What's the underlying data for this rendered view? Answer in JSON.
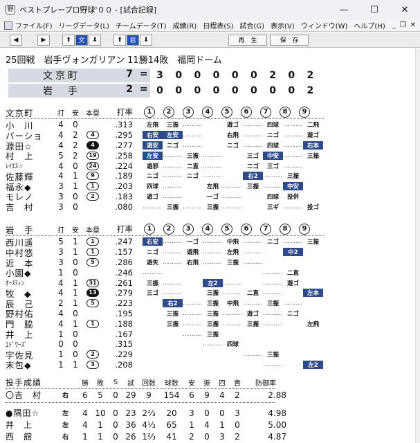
{
  "window": {
    "title": "ベストプレープロ野球'００ - [試合記録]",
    "minimize": "—",
    "maximize": "☐",
    "close": "✕",
    "app_icon": "野"
  },
  "menu": [
    "ファイル(F)",
    "リーグデータ(L)",
    "チームデータ(T)",
    "成績(R)",
    "日程表(S)",
    "試合(G)",
    "表示(V)",
    "ウィンドウ(W)",
    "ヘルプ(H)"
  ],
  "mdi": {
    "minimize": "_",
    "restore": "❐",
    "close": "✕"
  },
  "toolbar": {
    "left": "◀",
    "right": "▶",
    "up1": "⬆",
    "team1": "文",
    "down1": "⬇",
    "up2": "⬆",
    "team2": "岩",
    "down2": "⬇",
    "replay": "再　生",
    "save": "保　存"
  },
  "game": {
    "info": "25回戦　岩手ヴォンガリアン 11勝14敗　福岡ドーム"
  },
  "scoreboard": [
    {
      "team": "文京町",
      "total": "7",
      "dash": "=",
      "innings": [
        "3",
        "0",
        "0",
        "0",
        "0",
        "0",
        "2",
        "0",
        "2"
      ]
    },
    {
      "team": "岩　手",
      "total": "2",
      "dash": "=",
      "innings": [
        "0",
        "0",
        "0",
        "0",
        "0",
        "0",
        "0",
        "0",
        "2"
      ]
    }
  ],
  "headers": {
    "ab": "打",
    "h": "安",
    "hr": "本塁",
    "avg": "打率"
  },
  "inning_labels": [
    "1",
    "2",
    "3",
    "4",
    "5",
    "6",
    "7",
    "8",
    "9"
  ],
  "home": {
    "team": "文京町",
    "players": [
      {
        "name": "小　川",
        "ab": "4",
        "h": "0",
        "hr": "",
        "hrfill": false,
        "avg": ".313",
        "inn": [
          [
            "左飛",
            0
          ],
          [
            "三振",
            0
          ],
          [
            "…………",
            2
          ],
          [
            "",
            2
          ],
          [
            "遊ゴ",
            0
          ],
          [
            "…………",
            2
          ],
          [
            "四球",
            0
          ],
          [
            "…………",
            2
          ],
          [
            "二飛",
            0
          ]
        ]
      },
      {
        "name": "バーショ",
        "ab": "4",
        "h": "2",
        "hr": "4",
        "hrfill": false,
        "avg": ".295",
        "inn": [
          [
            "右安",
            1
          ],
          [
            "左安",
            1
          ],
          [
            "…………",
            2
          ],
          [
            "",
            2
          ],
          [
            "右飛",
            0
          ],
          [
            "…………",
            2
          ],
          [
            "ニゴ",
            0
          ],
          [
            "…………",
            2
          ],
          [
            "遊ゴ",
            0
          ]
        ]
      },
      {
        "name": "源田☆",
        "ab": "4",
        "h": "2",
        "hr": "4",
        "hrfill": true,
        "avg": ".277",
        "inn": [
          [
            "遊安",
            1
          ],
          [
            "ニゴ",
            0
          ],
          [
            "…………",
            2
          ],
          [
            "",
            2
          ],
          [
            "ニゴ",
            0
          ],
          [
            "…………",
            2
          ],
          [
            "四球",
            0
          ],
          [
            "…………",
            2
          ],
          [
            "右本",
            1
          ]
        ]
      },
      {
        "name": "村　上",
        "ab": "5",
        "h": "2",
        "hr": "19",
        "hrfill": false,
        "avg": ".258",
        "inn": [
          [
            "左安",
            1
          ],
          [
            "…………",
            2
          ],
          [
            "三振",
            0
          ],
          [
            "…………",
            2
          ],
          [
            "",
            2
          ],
          [
            "三ゴ",
            0
          ],
          [
            "中安",
            1
          ],
          [
            "…………",
            2
          ],
          [
            "三振",
            0
          ]
        ]
      },
      {
        "name": "ﾚｲｴｽ☆",
        "ab": "4",
        "h": "0",
        "hr": "24",
        "hrfill": false,
        "avg": ".224",
        "sm": true,
        "inn": [
          [
            "遊邪",
            0
          ],
          [
            "…………",
            2
          ],
          [
            "二直",
            0
          ],
          [
            "…………",
            2
          ],
          [
            "",
            2
          ],
          [
            "ニゴ",
            0
          ],
          [
            "三ゴ",
            0
          ],
          [
            "…………",
            2
          ],
          [
            "",
            2
          ]
        ]
      },
      {
        "name": "佐藤輝",
        "ab": "4",
        "h": "1",
        "hr": "9",
        "hrfill": false,
        "avg": ".189",
        "inn": [
          [
            "ニゴ",
            0
          ],
          [
            "…………",
            2
          ],
          [
            "ニゴ",
            0
          ],
          [
            "…………",
            2
          ],
          [
            "",
            2
          ],
          [
            "右2",
            1
          ],
          [
            "…………",
            2
          ],
          [
            "三振",
            0
          ],
          [
            "",
            2
          ]
        ]
      },
      {
        "name": "福永◆",
        "ab": "3",
        "h": "1",
        "hr": "1",
        "hrfill": false,
        "avg": ".203",
        "inn": [
          [
            "四球",
            0
          ],
          [
            "…………",
            2
          ],
          [
            "",
            2
          ],
          [
            "左飛",
            0
          ],
          [
            "…………",
            2
          ],
          [
            "三振",
            0
          ],
          [
            "…………",
            2
          ],
          [
            "中安",
            1
          ],
          [
            "",
            2
          ]
        ]
      },
      {
        "name": "モレノ",
        "ab": "3",
        "h": "0",
        "hr": "2",
        "hrfill": false,
        "avg": ".183",
        "inn": [
          [
            "遊ゴ",
            0
          ],
          [
            "…………",
            2
          ],
          [
            "",
            2
          ],
          [
            "一ゴ",
            0
          ],
          [
            "…………",
            2
          ],
          [
            "",
            2
          ],
          [
            "四球",
            0
          ],
          [
            "投併",
            0
          ],
          [
            "",
            2
          ]
        ]
      },
      {
        "name": "吉　村",
        "ab": "3",
        "h": "0",
        "hr": "",
        "hrfill": false,
        "avg": ".080",
        "inn": [
          [
            "…………",
            2
          ],
          [
            "三振",
            0
          ],
          [
            "…………",
            2
          ],
          [
            "三振",
            0
          ],
          [
            "…………",
            2
          ],
          [
            "",
            2
          ],
          [
            "三ギ",
            0
          ],
          [
            "…………",
            2
          ],
          [
            "投ゴ",
            0
          ]
        ]
      }
    ]
  },
  "away": {
    "team": "岩　手",
    "players": [
      {
        "name": "西川遥",
        "ab": "5",
        "h": "1",
        "hr": "1",
        "hrfill": false,
        "avg": ".247",
        "inn": [
          [
            "右安",
            1
          ],
          [
            "…………",
            2
          ],
          [
            "一ゴ",
            0
          ],
          [
            "…………",
            2
          ],
          [
            "中飛",
            0
          ],
          [
            "…………",
            2
          ],
          [
            "ニゴ",
            0
          ],
          [
            "…………",
            2
          ],
          [
            "三振",
            0
          ]
        ]
      },
      {
        "name": "中村悠",
        "ab": "3",
        "h": "1",
        "hr": "1",
        "hrfill": false,
        "avg": ".157",
        "inn": [
          [
            "ニゴ",
            0
          ],
          [
            "…………",
            2
          ],
          [
            "遊飛",
            0
          ],
          [
            "…………",
            2
          ],
          [
            "左飛",
            0
          ],
          [
            "…………",
            2
          ],
          [
            "",
            2
          ],
          [
            "中2",
            1
          ],
          [
            "",
            2
          ]
        ]
      },
      {
        "name": "近　本",
        "ab": "3",
        "h": "0",
        "hr": "5",
        "hrfill": false,
        "avg": ".286",
        "inn": [
          [
            "遊失",
            0
          ],
          [
            "…………",
            2
          ],
          [
            "右飛",
            0
          ],
          [
            "…………",
            2
          ],
          [
            "三振",
            0
          ],
          [
            "…………",
            2
          ],
          [
            "",
            2
          ],
          [
            "",
            2
          ],
          [
            "",
            2
          ]
        ]
      },
      {
        "name": "小園◆",
        "ab": "1",
        "h": "0",
        "hr": "",
        "hrfill": false,
        "avg": ".246",
        "inn": [
          [
            "…………",
            2
          ],
          [
            "",
            2
          ],
          [
            "",
            2
          ],
          [
            "",
            2
          ],
          [
            "",
            2
          ],
          [
            "",
            2
          ],
          [
            "…………",
            2
          ],
          [
            "二直",
            0
          ],
          [
            "",
            2
          ]
        ]
      },
      {
        "name": "ｵｰｽﾃｨﾝ",
        "ab": "4",
        "h": "1",
        "hr": "31",
        "hrfill": false,
        "avg": ".261",
        "sm": true,
        "inn": [
          [
            "三振",
            0
          ],
          [
            "…………",
            2
          ],
          [
            "",
            2
          ],
          [
            "左2",
            1
          ],
          [
            "…………",
            2
          ],
          [
            "",
            2
          ],
          [
            "…………",
            2
          ],
          [
            "遊ゴ",
            0
          ],
          [
            "",
            2
          ]
        ]
      },
      {
        "name": "牧　◆",
        "ab": "4",
        "h": "1",
        "hr": "13",
        "hrfill": true,
        "avg": ".279",
        "inn": [
          [
            "三ゴ",
            0
          ],
          [
            "…………",
            2
          ],
          [
            "",
            2
          ],
          [
            "三振",
            0
          ],
          [
            "…………",
            2
          ],
          [
            "二直",
            0
          ],
          [
            "…………",
            2
          ],
          [
            "",
            2
          ],
          [
            "左本",
            1
          ]
        ]
      },
      {
        "name": "辰　己",
        "ab": "2",
        "h": "1",
        "hr": "5",
        "hrfill": false,
        "avg": ".223",
        "inn": [
          [
            "",
            2
          ],
          [
            "右2",
            1
          ],
          [
            "…………",
            2
          ],
          [
            "三振",
            0
          ],
          [
            "中飛",
            0
          ],
          [
            "…………",
            2
          ],
          [
            "三振",
            0
          ],
          [
            "…………",
            2
          ],
          [
            "",
            2
          ]
        ]
      },
      {
        "name": "野村佑",
        "ab": "4",
        "h": "0",
        "hr": "",
        "hrfill": false,
        "avg": ".195",
        "inn": [
          [
            "",
            2
          ],
          [
            "三振",
            0
          ],
          [
            "…………",
            2
          ],
          [
            "三振",
            0
          ],
          [
            "…………",
            2
          ],
          [
            "遊ゴ",
            0
          ],
          [
            "…………",
            2
          ],
          [
            "ニゴ",
            0
          ],
          [
            "",
            2
          ]
        ]
      },
      {
        "name": "門　脇",
        "ab": "4",
        "h": "1",
        "hr": "1",
        "hrfill": false,
        "avg": ".188",
        "inn": [
          [
            "",
            2
          ],
          [
            "三振",
            0
          ],
          [
            "…………",
            2
          ],
          [
            "三振",
            0
          ],
          [
            "…………",
            2
          ],
          [
            "三振",
            0
          ],
          [
            "…………",
            2
          ],
          [
            "",
            2
          ],
          [
            "左飛",
            0
          ]
        ]
      },
      {
        "name": "井　上",
        "ab": "1",
        "h": "0",
        "hr": "",
        "hrfill": false,
        "avg": ".167",
        "inn": [
          [
            "",
            2
          ],
          [
            "",
            2
          ],
          [
            "…………",
            2
          ],
          [
            "三振",
            0
          ],
          [
            "",
            2
          ],
          [
            "",
            2
          ],
          [
            "",
            2
          ],
          [
            "",
            2
          ],
          [
            "",
            2
          ]
        ]
      },
      {
        "name": "ｴﾄﾞﾜｰｽﾞ",
        "ab": "0",
        "h": "0",
        "hr": "",
        "hrfill": false,
        "avg": ".315",
        "sm": true,
        "inn": [
          [
            "",
            2
          ],
          [
            "",
            2
          ],
          [
            "",
            2
          ],
          [
            "…………",
            2
          ],
          [
            "四球",
            0
          ],
          [
            "",
            2
          ],
          [
            "",
            2
          ],
          [
            "",
            2
          ],
          [
            "",
            2
          ]
        ]
      },
      {
        "name": "宇佐見",
        "ab": "1",
        "h": "0",
        "hr": "2",
        "hrfill": false,
        "avg": ".229",
        "inn": [
          [
            "",
            2
          ],
          [
            "",
            2
          ],
          [
            "",
            2
          ],
          [
            "",
            2
          ],
          [
            "",
            2
          ],
          [
            "…………",
            2
          ],
          [
            "三振",
            0
          ],
          [
            "",
            2
          ],
          [
            "",
            2
          ]
        ]
      },
      {
        "name": "末包◆",
        "ab": "1",
        "h": "1",
        "hr": "3",
        "hrfill": false,
        "avg": ".208",
        "inn": [
          [
            "",
            2
          ],
          [
            "",
            2
          ],
          [
            "",
            2
          ],
          [
            "",
            2
          ],
          [
            "",
            2
          ],
          [
            "",
            2
          ],
          [
            "…………",
            2
          ],
          [
            "",
            2
          ],
          [
            "左2",
            1
          ]
        ]
      }
    ]
  },
  "pitching": {
    "title": "投手成績",
    "headers": [
      "勝",
      "敗",
      "S",
      "試",
      "回数",
      "球数",
      "安",
      "振",
      "四",
      "責",
      "防御率"
    ],
    "pitchers": [
      {
        "name": "〇吉　村",
        "hand": "右",
        "w": "6",
        "l": "5",
        "s": "0",
        "g": "29",
        "ip": "9",
        "np": "154",
        "h": "6",
        "so": "9",
        "bb": "4",
        "er": "2",
        "era": "2.88"
      },
      {
        "name": "●隅田☆",
        "hand": "左",
        "w": "4",
        "l": "10",
        "s": "0",
        "g": "23",
        "ip": "2⅔",
        "np": "20",
        "h": "3",
        "so": "0",
        "bb": "0",
        "er": "3",
        "era": "4.98"
      },
      {
        "name": "井　上",
        "hand": "左",
        "w": "4",
        "l": "1",
        "s": "0",
        "g": "36",
        "ip": "4⅓",
        "np": "65",
        "h": "1",
        "so": "4",
        "bb": "1",
        "er": "0",
        "era": "5.00"
      },
      {
        "name": "西　舘",
        "hand": "右",
        "w": "1",
        "l": "1",
        "s": "0",
        "g": "26",
        "ip": "1⅔",
        "np": "41",
        "h": "2",
        "so": "0",
        "bb": "3",
        "er": "2",
        "era": "4.87"
      }
    ]
  }
}
